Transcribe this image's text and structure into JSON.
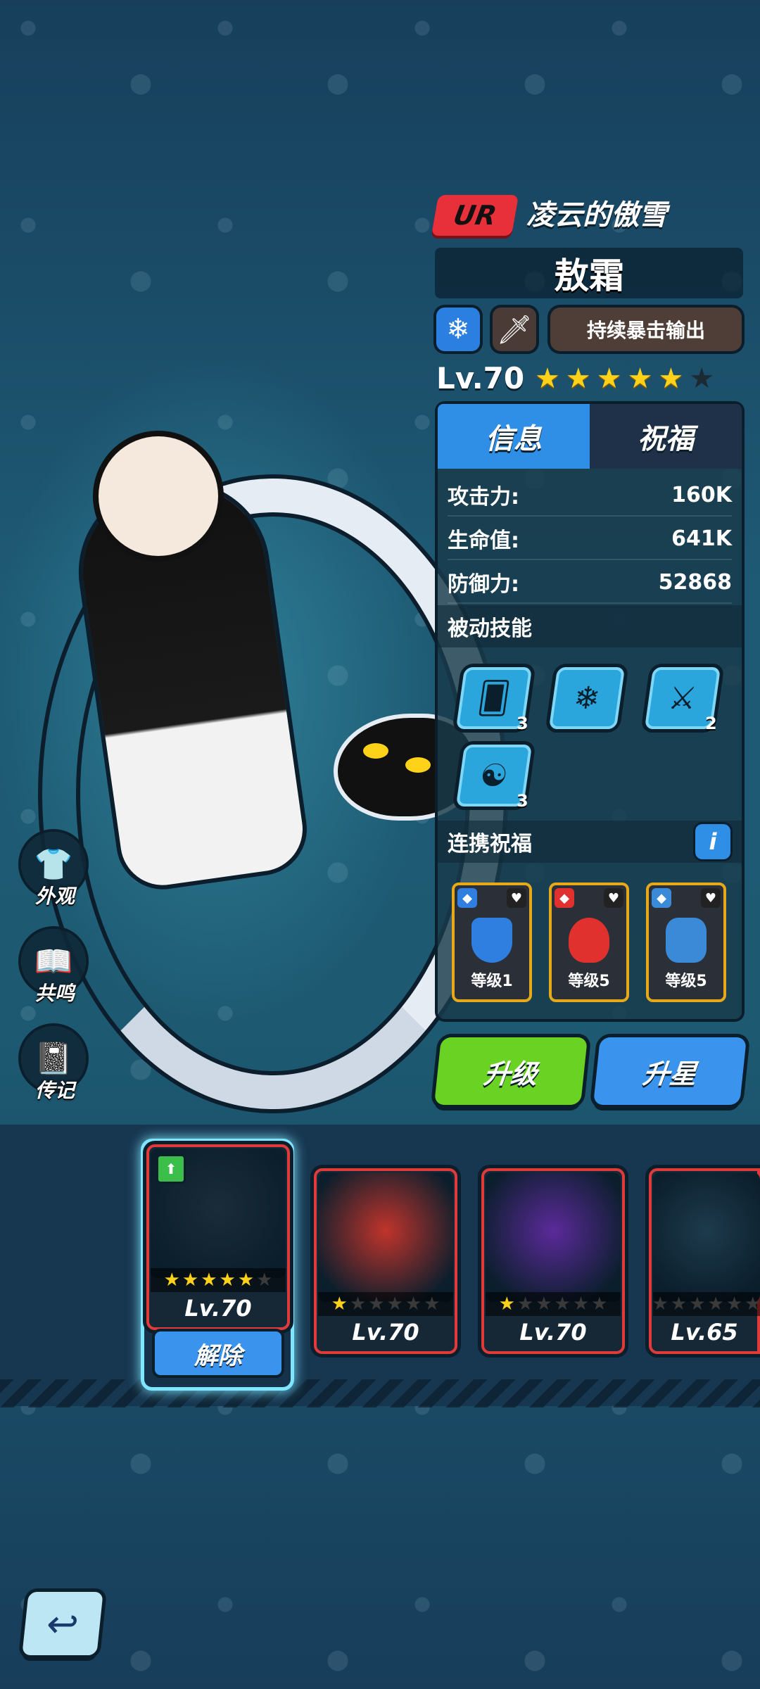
{
  "hero": {
    "rarity": "UR",
    "title": "凌云的傲雪",
    "name": "敖霜",
    "element_icon": "snowflake-icon",
    "weapon_icon": "sword-icon",
    "role": "持续暴击输出",
    "level": "Lv.70",
    "stars": 5,
    "max_stars": 6
  },
  "panel": {
    "tabs": [
      "信息",
      "祝福"
    ],
    "active_tab": 0,
    "stats": [
      {
        "label": "攻击力:",
        "value": "160K"
      },
      {
        "label": "生命值:",
        "value": "641K"
      },
      {
        "label": "防御力:",
        "value": "52868"
      }
    ],
    "passive_title": "被动技能",
    "passive_skills": [
      {
        "icon": "cards-icon",
        "count": "3"
      },
      {
        "icon": "snowflake-cluster-icon",
        "count": ""
      },
      {
        "icon": "triple-slash-icon",
        "count": "2"
      },
      {
        "icon": "dragon-crest-icon",
        "count": "3"
      }
    ],
    "bond_title": "连携祝福",
    "bond_cards": [
      {
        "label": "等级1",
        "color": "#2e7fe0"
      },
      {
        "label": "等级5",
        "color": "#e0312f"
      },
      {
        "label": "等级5",
        "color": "#3a8ad8"
      }
    ]
  },
  "buttons": {
    "upgrade": "升级",
    "star_up": "升星",
    "unequip": "解除"
  },
  "side_menu": [
    {
      "label": "外观",
      "icon": "shirt-icon"
    },
    {
      "label": "共鸣",
      "icon": "book-icon"
    },
    {
      "label": "传记",
      "icon": "journal-icon"
    }
  ],
  "pets": [
    {
      "level": "Lv.70",
      "stars": 5,
      "max_stars": 6,
      "frame": "#e03a3a",
      "bg": "#1a2c3a"
    },
    {
      "level": "Lv.70",
      "stars": 1,
      "max_stars": 6,
      "frame": "#e03a3a",
      "bg": "#c0342c"
    },
    {
      "level": "Lv.70",
      "stars": 1,
      "max_stars": 6,
      "frame": "#e03a3a",
      "bg": "#5b2a9a"
    },
    {
      "level": "Lv.65",
      "stars": 0,
      "max_stars": 6,
      "frame": "#e03a3a",
      "bg": "#1d3b4c"
    }
  ]
}
